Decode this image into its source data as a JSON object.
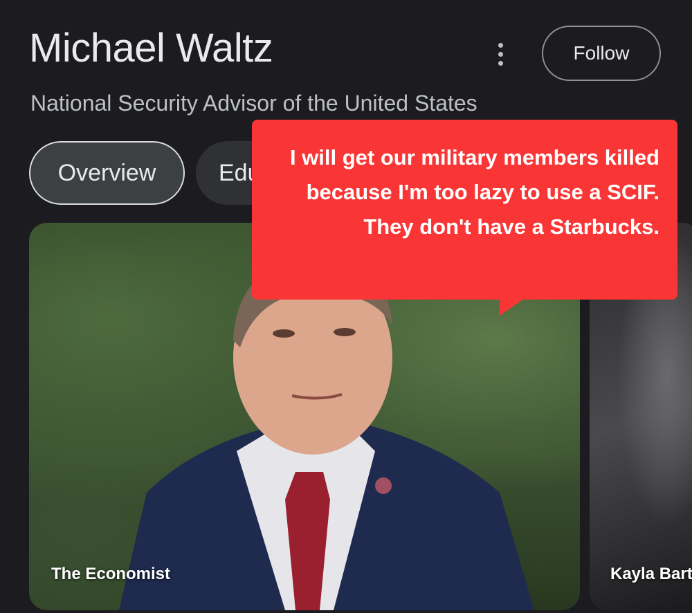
{
  "header": {
    "title": "Michael Waltz",
    "subtitle": "National Security Advisor of the United States",
    "follow_label": "Follow",
    "more_icon": "more-vert-icon"
  },
  "tabs": [
    {
      "label": "Overview",
      "selected": true
    },
    {
      "label": "Edu",
      "selected": false
    }
  ],
  "cards": [
    {
      "caption": "The Economist",
      "image": "portrait photo of a man in navy suit with red tie, outdoors with trees"
    },
    {
      "caption": "Kayla Bart",
      "image": "partially visible photo"
    }
  ],
  "overlay": {
    "text": "I will get our military members killed because I'm too lazy to use a SCIF. They don't have a Starbucks.",
    "color": "#f93535"
  }
}
